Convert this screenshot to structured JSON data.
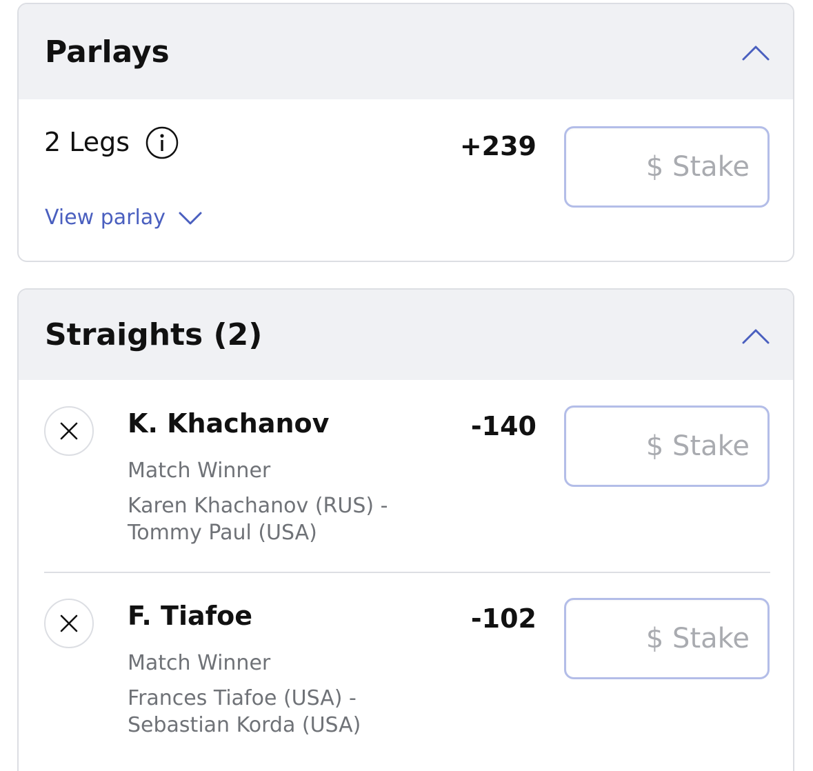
{
  "parlays": {
    "title": "Parlays",
    "legs_label": "2 Legs",
    "odds": "+239",
    "stake_placeholder": "$ Stake",
    "view_parlay_label": "View parlay"
  },
  "straights": {
    "title": "Straights (2)",
    "bets": [
      {
        "selection": "K. Khachanov",
        "odds": "-140",
        "market": "Match Winner",
        "event_line1": "Karen Khachanov (RUS) -",
        "event_line2": "Tommy Paul (USA)",
        "stake_placeholder": "$ Stake"
      },
      {
        "selection": "F. Tiafoe",
        "odds": "-102",
        "market": "Match Winner",
        "event_line1": "Frances Tiafoe (USA) -",
        "event_line2": "Sebastian Korda (USA)",
        "stake_placeholder": "$ Stake"
      }
    ]
  },
  "colors": {
    "accent": "#4a5fbf",
    "header_bg": "#f0f1f4",
    "stake_border": "#b3bde8",
    "muted_text": "#6f7277"
  },
  "icons": {
    "collapse": "chevron-up-icon",
    "info": "info-icon",
    "expand": "chevron-down-icon",
    "remove": "close-icon"
  }
}
